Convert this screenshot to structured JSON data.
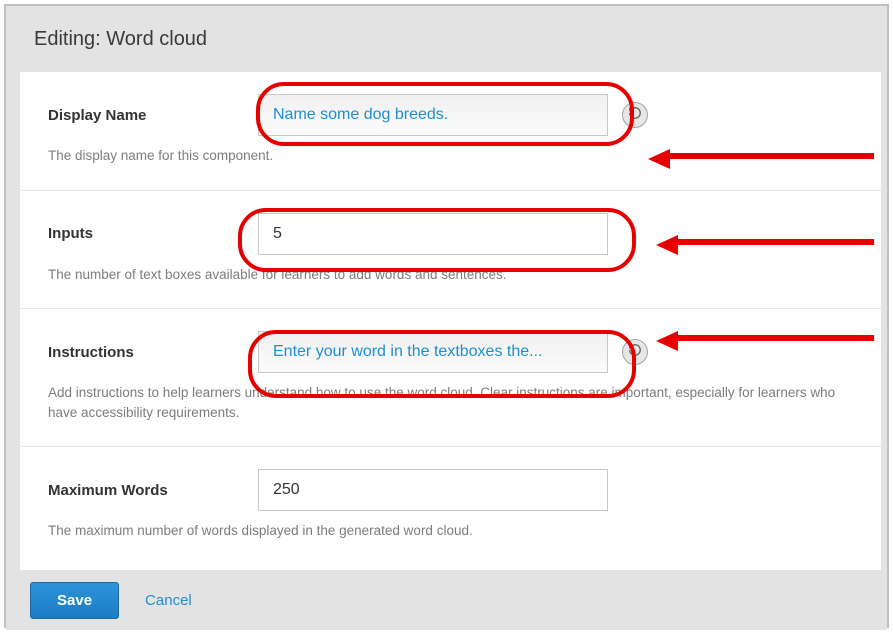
{
  "header": {
    "title": "Editing: Word cloud"
  },
  "fields": {
    "display_name": {
      "label": "Display Name",
      "value": "Name some dog breeds.",
      "help": "The display name for this component."
    },
    "inputs": {
      "label": "Inputs",
      "value": "5",
      "help": "The number of text boxes available for learners to add words and sentences."
    },
    "instructions": {
      "label": "Instructions",
      "value": "Enter your word in the textboxes the...",
      "help": "Add instructions to help learners understand how to use the word cloud. Clear instructions are important, especially for learners who have accessibility requirements."
    },
    "max_words": {
      "label": "Maximum Words",
      "value": "250",
      "help": "The maximum number of words displayed in the generated word cloud."
    }
  },
  "footer": {
    "save": "Save",
    "cancel": "Cancel"
  },
  "icons": {
    "revert": "revert-icon"
  }
}
